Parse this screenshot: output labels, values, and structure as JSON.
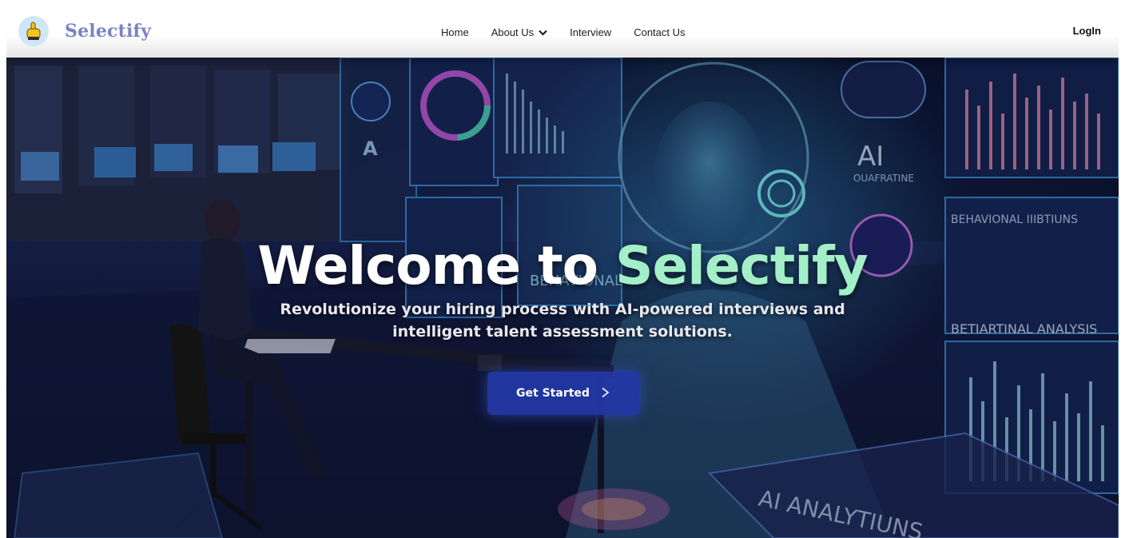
{
  "brand": {
    "name": "Selectify",
    "logo_icon": "pointing-hand-icon"
  },
  "nav": {
    "links": [
      {
        "label": "Home"
      },
      {
        "label": "About Us",
        "dropdown": true
      },
      {
        "label": "Interview"
      },
      {
        "label": "Contact Us"
      }
    ],
    "login_label": "LogIn"
  },
  "hero": {
    "title_prefix": "Welcome to ",
    "title_accent": "Selectify",
    "subtitle": "Revolutionize your hiring process with AI-powered interviews and intelligent talent assessment solutions.",
    "cta_label": "Get Started",
    "cta_icon": "chevron-right-icon",
    "background_texts": [
      "AI",
      "BEHAVIONAL IIIBTIUNS",
      "BETIARTINAL ANALYSIS",
      "BEHAVIONAL ANALYSIS",
      "AI ANALYTIUNS",
      "A",
      "OUAFRATINE"
    ]
  },
  "colors": {
    "brand_text": "#7a84c4",
    "title_accent": "#a3efc7",
    "cta_bg": "#2438aa",
    "navbar_bg": "#ffffff"
  }
}
